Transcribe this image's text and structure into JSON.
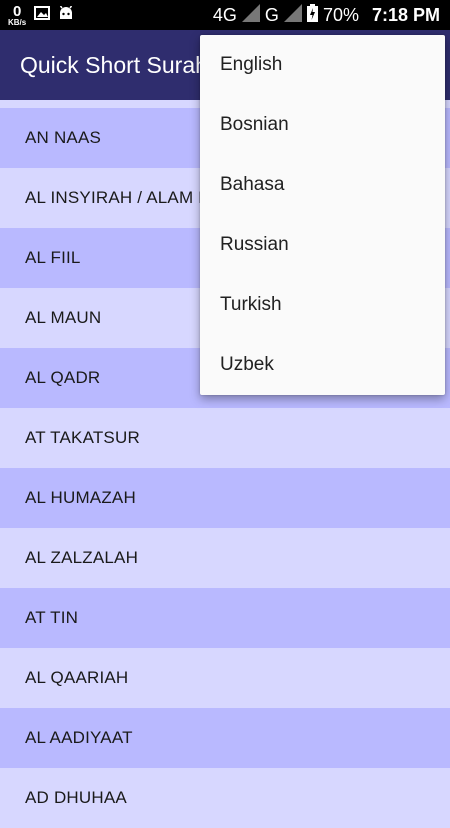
{
  "status_bar": {
    "speed_value": "0",
    "speed_unit": "KB/s",
    "network_4g": "4G",
    "network_g": "G",
    "battery": "70%",
    "time": "7:18 PM"
  },
  "toolbar": {
    "title": "Quick Short Surah"
  },
  "list": {
    "items": [
      "AN NAAS",
      "AL INSYIRAH / ALAM NASYRAH",
      "AL FIIL",
      "AL MAUN",
      "AL QADR",
      "AT TAKATSUR",
      "AL HUMAZAH",
      "AL ZALZALAH",
      "AT TIN",
      "AL QAARIAH",
      "AL AADIYAAT",
      "AD DHUHAA"
    ]
  },
  "menu": {
    "items": [
      "English",
      "Bosnian",
      "Bahasa",
      "Russian",
      "Turkish",
      "Uzbek"
    ]
  },
  "colors": {
    "toolbar": "#2f2d6e",
    "row_dark": "#b9b9ff",
    "row_light": "#d7d7ff",
    "menu_bg": "#fafafa"
  },
  "icons": [
    "image-icon",
    "android-icon",
    "signal-icon",
    "battery-icon"
  ]
}
